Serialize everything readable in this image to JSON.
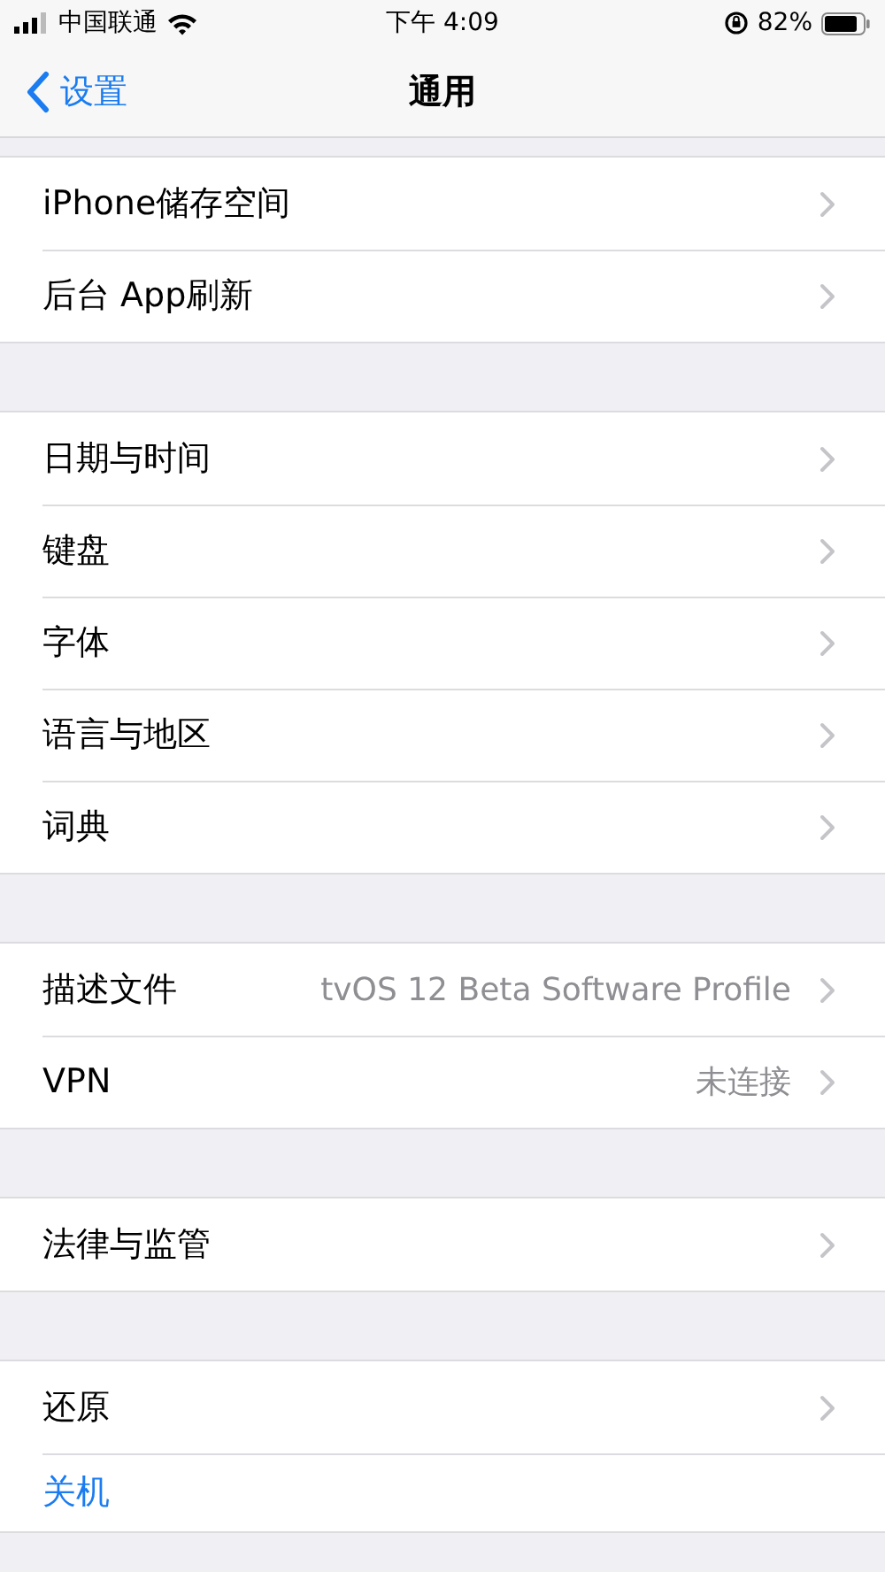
{
  "status_bar": {
    "carrier": "中国联通",
    "time": "下午 4:09",
    "battery": "82%"
  },
  "nav": {
    "back": "设置",
    "title": "通用"
  },
  "groups": [
    {
      "rows": [
        {
          "kind": "link",
          "label": "iPhone储存空间"
        },
        {
          "kind": "link",
          "label": "后台 App刷新"
        }
      ]
    },
    {
      "rows": [
        {
          "kind": "link",
          "label": "日期与时间"
        },
        {
          "kind": "link",
          "label": "键盘"
        },
        {
          "kind": "link",
          "label": "字体"
        },
        {
          "kind": "link",
          "label": "语言与地区"
        },
        {
          "kind": "link",
          "label": "词典"
        }
      ]
    },
    {
      "rows": [
        {
          "kind": "link",
          "label": "描述文件",
          "value": "tvOS 12 Beta Software Profile"
        },
        {
          "kind": "link",
          "label": "VPN",
          "value": "未连接"
        }
      ]
    },
    {
      "rows": [
        {
          "kind": "link",
          "label": "法律与监管"
        }
      ]
    },
    {
      "rows": [
        {
          "kind": "link",
          "label": "还原"
        },
        {
          "kind": "action",
          "label": "关机"
        }
      ]
    }
  ]
}
